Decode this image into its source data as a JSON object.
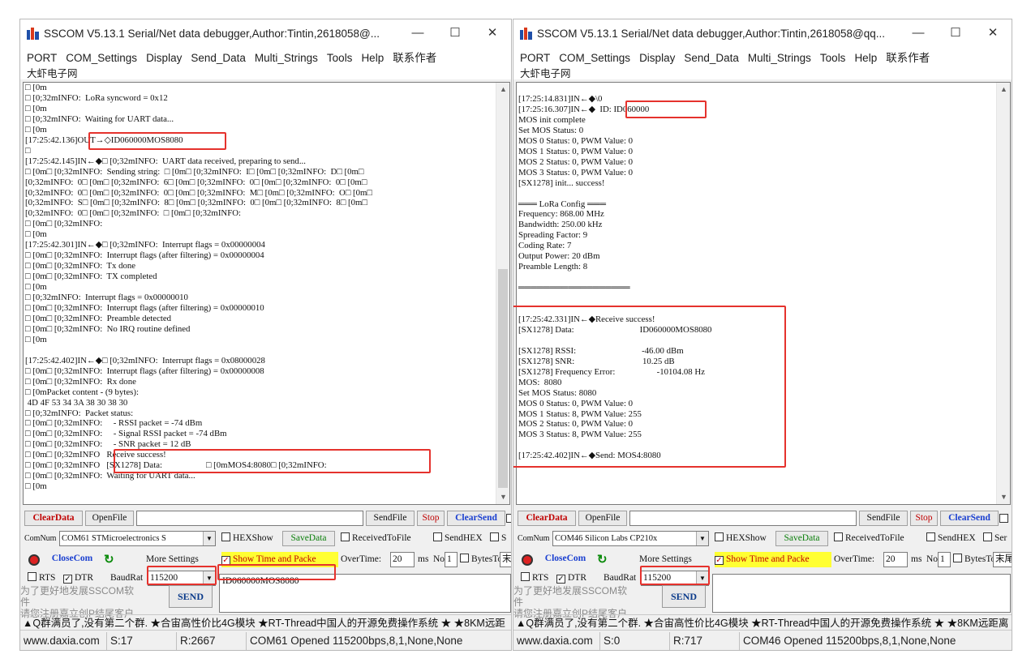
{
  "left": {
    "title": "SSCOM V5.13.1 Serial/Net data debugger,Author:Tintin,2618058@...",
    "menu": [
      "PORT",
      "COM_Settings",
      "Display",
      "Send_Data",
      "Multi_Strings",
      "Tools",
      "Help",
      "联系作者"
    ],
    "menu2": "大虾电子网",
    "terminal_lines": [
      "□ [0m",
      "□ [0;32mINFO:  LoRa syncword = 0x12",
      "□ [0m",
      "□ [0;32mINFO:  Waiting for UART data...",
      "□ [0m",
      "[17:25:42.136]OUT→◇ID060000MOS8080",
      "□",
      "[17:25:42.145]IN←◆□ [0;32mINFO:  UART data received, preparing to send...",
      "□ [0m□ [0;32mINFO:  Sending string:  □ [0m□ [0;32mINFO:  I□ [0m□ [0;32mINFO:  D□ [0m□",
      "[0;32mINFO:  0□ [0m□ [0;32mINFO:  6□ [0m□ [0;32mINFO:  0□ [0m□ [0;32mINFO:  0□ [0m□",
      "[0;32mINFO:  0□ [0m□ [0;32mINFO:  0□ [0m□ [0;32mINFO:  M□ [0m□ [0;32mINFO:  O□ [0m□",
      "[0;32mINFO:  S□ [0m□ [0;32mINFO:  8□ [0m□ [0;32mINFO:  0□ [0m□ [0;32mINFO:  8□ [0m□",
      "[0;32mINFO:  0□ [0m□ [0;32mINFO:  □ [0m□ [0;32mINFO:",
      "□ [0m□ [0;32mINFO:",
      "□ [0m",
      "[17:25:42.301]IN←◆□ [0;32mINFO:  Interrupt flags = 0x00000004",
      "□ [0m□ [0;32mINFO:  Interrupt flags (after filtering) = 0x00000004",
      "□ [0m□ [0;32mINFO:  Tx done",
      "□ [0m□ [0;32mINFO:  TX completed",
      "□ [0m",
      "□ [0;32mINFO:  Interrupt flags = 0x00000010",
      "□ [0m□ [0;32mINFO:  Interrupt flags (after filtering) = 0x00000010",
      "□ [0m□ [0;32mINFO:  Preamble detected",
      "□ [0m□ [0;32mINFO:  No IRQ routine defined",
      "□ [0m",
      "",
      "[17:25:42.402]IN←◆□ [0;32mINFO:  Interrupt flags = 0x08000028",
      "□ [0m□ [0;32mINFO:  Interrupt flags (after filtering) = 0x00000008",
      "□ [0m□ [0;32mINFO:  Rx done",
      "□ [0mPacket content - (9 bytes):",
      " 4D 4F 53 34 3A 38 30 38 30",
      "□ [0;32mINFO:  Packet status:",
      "□ [0m□ [0;32mINFO:     - RSSI packet = -74 dBm",
      "□ [0m□ [0;32mINFO:     - Signal RSSI packet = -74 dBm",
      "□ [0m□ [0;32mINFO:     - SNR packet = 12 dB",
      "□ [0m□ [0;32mINFO   Receive success!",
      "□ [0m□ [0;32mINFO   [SX1278] Data:                    □ [0mMOS4:8080□ [0;32mINFO:",
      "□ [0m□ [0;32mINFO:  Waiting for UART data...",
      "□ [0m"
    ],
    "toolbar": {
      "clear_data": "ClearData",
      "open_file": "OpenFile",
      "send_file": "SendFile",
      "stop": "Stop",
      "clear_send": "ClearSend"
    },
    "com_num_label": "ComNum",
    "com_port_value": "COM61 STMicroelectronics S",
    "hex_show": "HEXShow",
    "save_data": "SaveData",
    "received_to_file": "ReceivedToFile",
    "send_hex": "SendHEX",
    "send_every": "S",
    "close_com": "CloseCom",
    "more_settings": "More Settings",
    "show_time": "Show Time and Packe",
    "overtime_label": "OverTime:",
    "overtime_value": "20",
    "ms_label": "ms",
    "no_label": "No",
    "bytes_value": "1",
    "bytes_label": "BytesTo",
    "end_field": "末",
    "rts": "RTS",
    "dtr": "DTR",
    "baud_label": "BaudRat",
    "baud_value": "115200",
    "send_text": "ID060000MOS8080",
    "promo": [
      "为了更好地发展SSCOM软件",
      "请您注册嘉立创P结尾客户"
    ],
    "send_button": "SEND",
    "marquee": "▲Q群满员了,没有第二个群. ★合宙高性价比4G模块 ★RT-Thread中国人的开源免费操作系统 ★ ★8KM远距",
    "status": {
      "site": "www.daxia.com",
      "s": "S:17",
      "r": "R:2667",
      "port_info": "COM61 Opened  115200bps,8,1,None,None"
    }
  },
  "right": {
    "title": "SSCOM V5.13.1 Serial/Net data debugger,Author:Tintin,2618058@qq...",
    "menu": [
      "PORT",
      "COM_Settings",
      "Display",
      "Send_Data",
      "Multi_Strings",
      "Tools",
      "Help",
      "联系作者"
    ],
    "menu2": "大虾电子网",
    "terminal_lines": [
      "[17:25:14.831]IN←◆\\0",
      "[17:25:16.307]IN←◆  ID: ID060000",
      "MOS init complete",
      "Set MOS Status: 0",
      "MOS 0 Status: 0, PWM Value: 0",
      "MOS 1 Status: 0, PWM Value: 0",
      "MOS 2 Status: 0, PWM Value: 0",
      "MOS 3 Status: 0, PWM Value: 0",
      "[SX1278] init... success!",
      "",
      "═══ LoRa Config ═══",
      "Frequency: 868.00 MHz",
      "Bandwidth: 250.00 kHz",
      "Spreading Factor: 9",
      "Coding Rate: 7",
      "Output Power: 20 dBm",
      "Preamble Length: 8",
      "",
      "══════════════════",
      "",
      "",
      "[17:25:42.331]IN←◆Receive success!",
      "[SX1278] Data:                              ID060000MOS8080",
      "",
      "[SX1278] RSSI:                              -46.00 dBm",
      "[SX1278] SNR:                               10.25 dB",
      "[SX1278] Frequency Error:                   -10104.08 Hz",
      "MOS:  8080",
      "Set MOS Status: 8080",
      "MOS 0 Status: 0, PWM Value: 0",
      "MOS 1 Status: 8, PWM Value: 255",
      "MOS 2 Status: 0, PWM Value: 0",
      "MOS 3 Status: 8, PWM Value: 255",
      "",
      "[17:25:42.402]IN←◆Send: MOS4:8080"
    ],
    "toolbar": {
      "clear_data": "ClearData",
      "open_file": "OpenFile",
      "send_file": "SendFile",
      "stop": "Stop",
      "clear_send": "ClearSend"
    },
    "com_num_label": "ComNum",
    "com_port_value": "COM46 Silicon Labs CP210x",
    "hex_show": "HEXShow",
    "save_data": "SaveData",
    "received_to_file": "ReceivedToFile",
    "send_hex": "SendHEX",
    "send_every": "Ser",
    "close_com": "CloseCom",
    "more_settings": "More Settings",
    "show_time": "Show Time and Packe",
    "overtime_label": "OverTime:",
    "overtime_value": "20",
    "ms_label": "ms",
    "no_label": "No",
    "bytes_value": "1",
    "bytes_label": "BytesTo",
    "end_field": "末尾",
    "rts": "RTS",
    "dtr": "DTR",
    "baud_label": "BaudRat",
    "baud_value": "115200",
    "send_text": "",
    "promo": [
      "为了更好地发展SSCOM软件",
      "请您注册嘉立创P结尾客户"
    ],
    "send_button": "SEND",
    "marquee": "▲Q群满员了,没有第二个群. ★合宙高性价比4G模块 ★RT-Thread中国人的开源免费操作系统 ★ ★8KM远距离",
    "status": {
      "site": "www.daxia.com",
      "s": "S:0",
      "r": "R:717",
      "port_info": "COM46 Opened  115200bps,8,1,None,None"
    }
  },
  "colors": {
    "highlight": "#e5322d",
    "clear_data": "#c00000",
    "clear_send": "#0a7f0a",
    "show_time_bg": "#ffff33"
  }
}
